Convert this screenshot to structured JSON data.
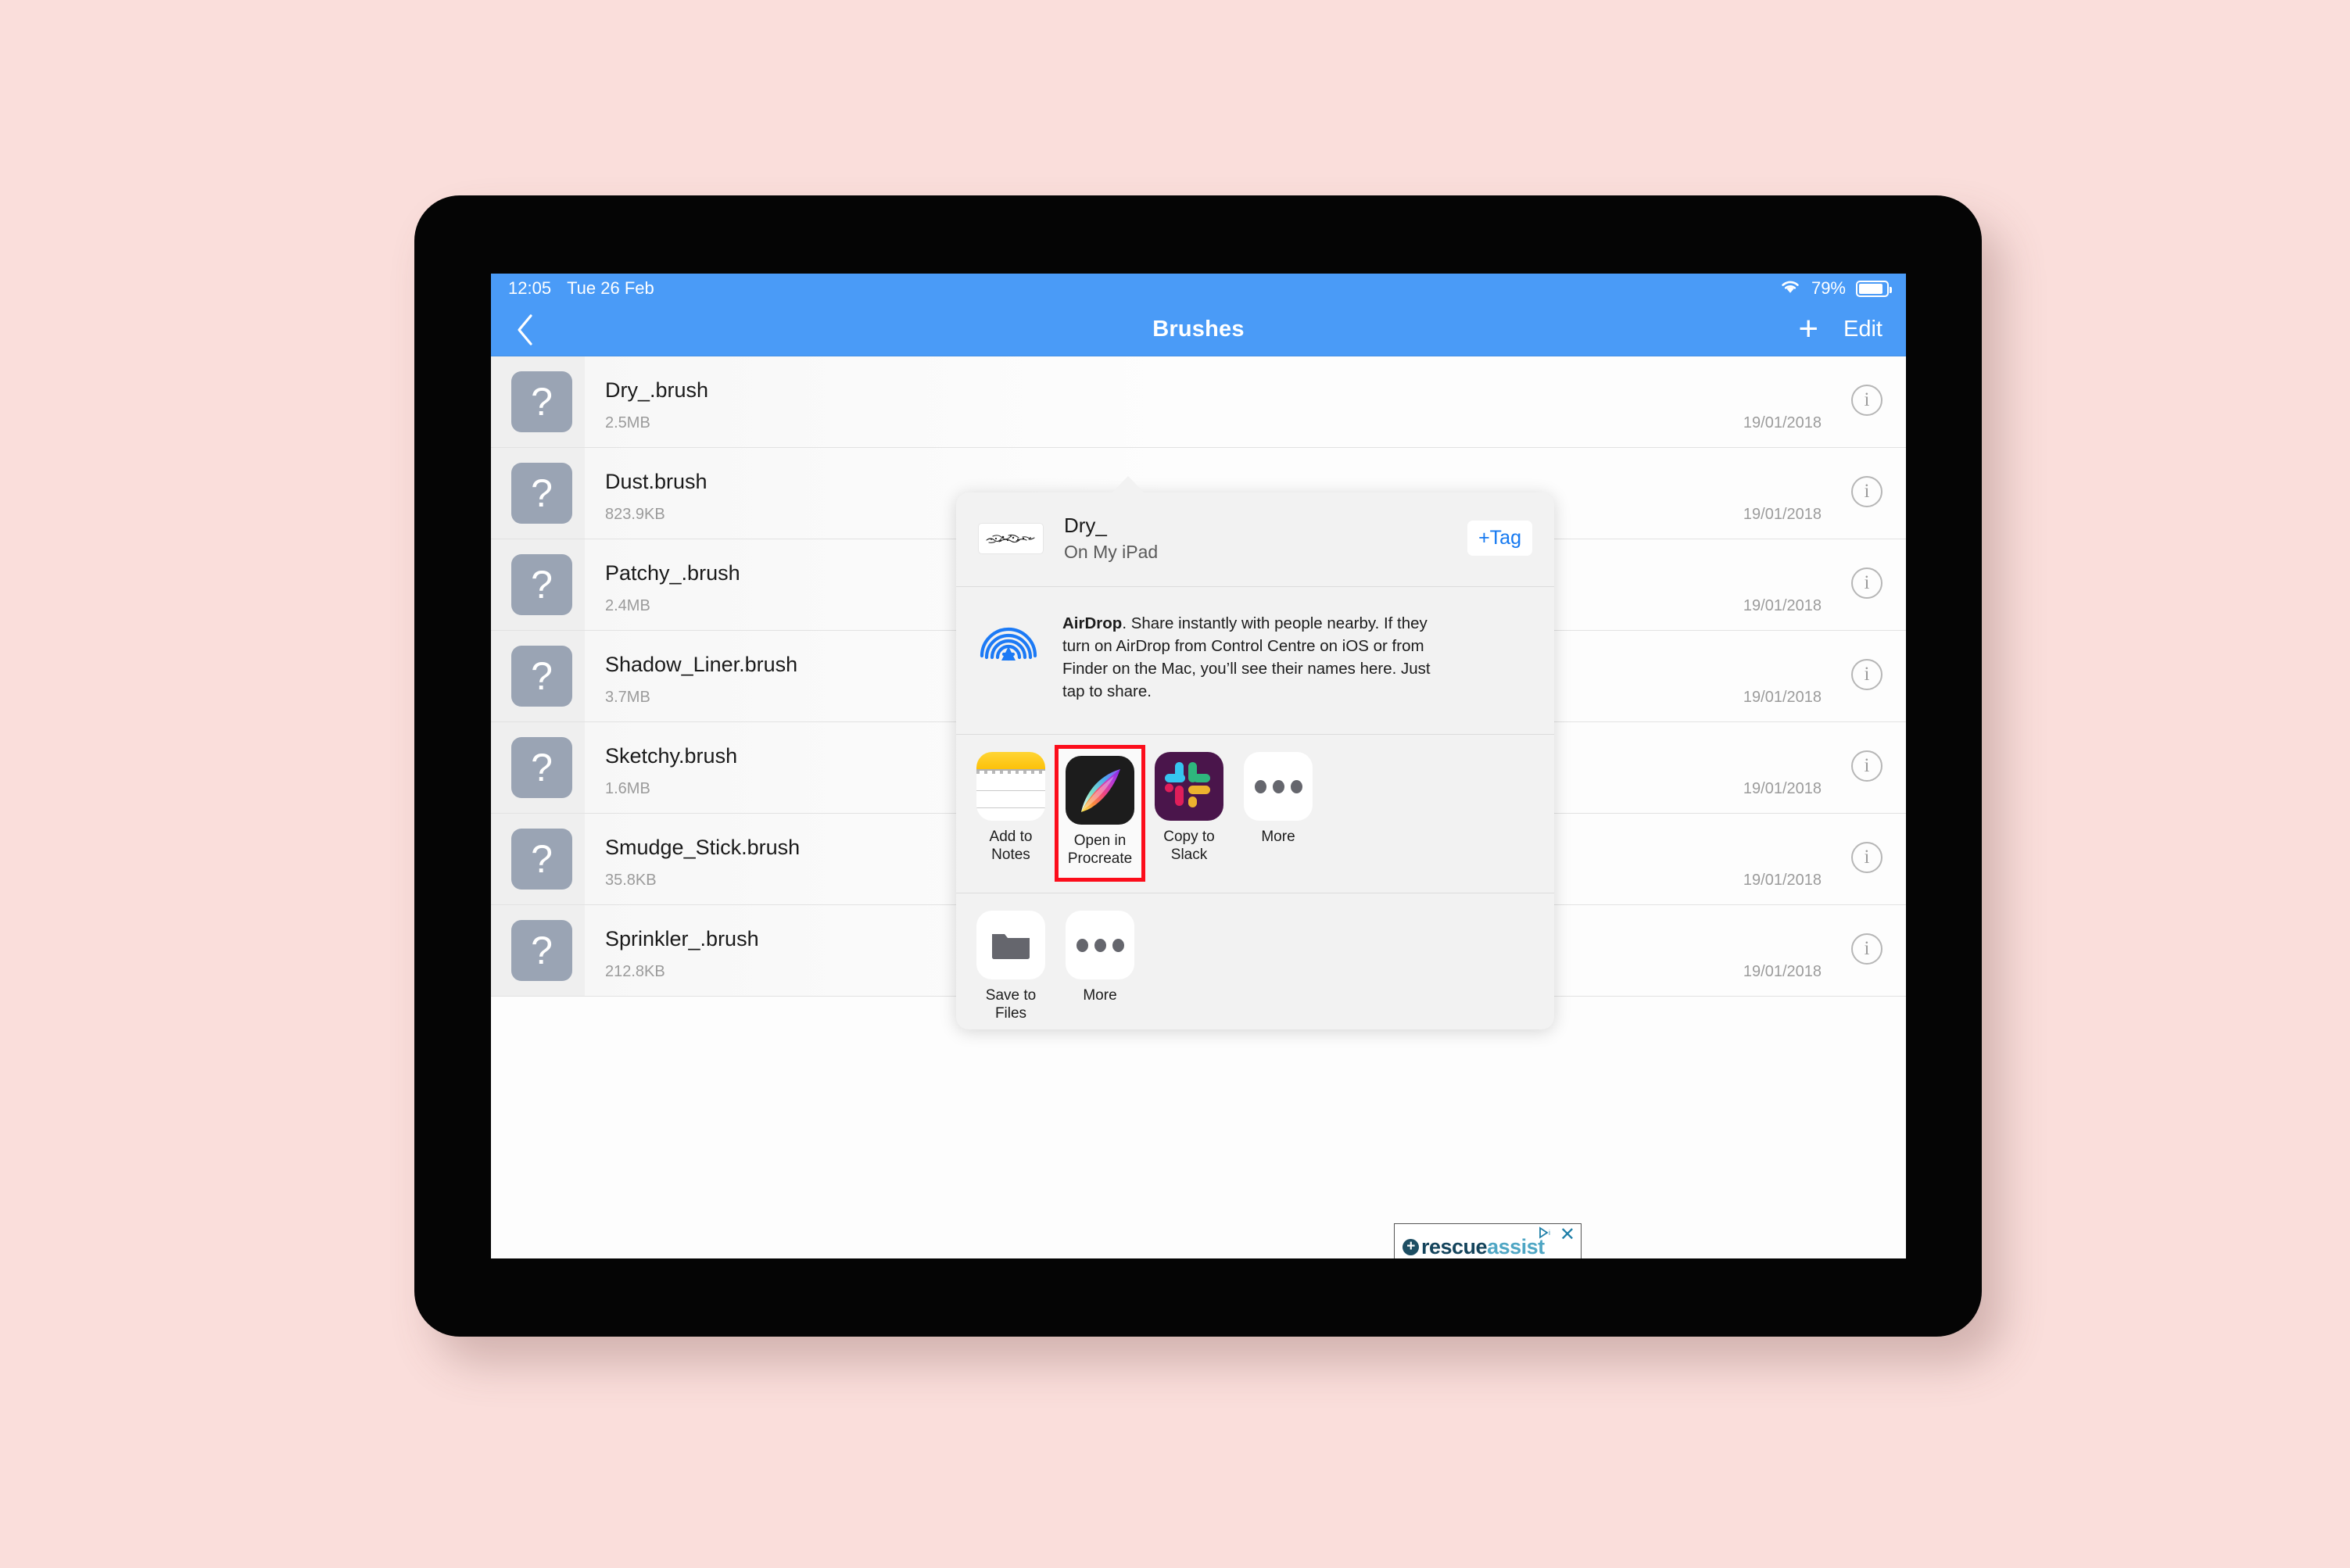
{
  "status_bar": {
    "time": "12:05",
    "date": "Tue 26 Feb",
    "battery_percent": "79%",
    "wifi_icon": "wifi-icon",
    "battery_icon": "battery-icon"
  },
  "nav_bar": {
    "back_icon": "chevron-left-icon",
    "title": "Brushes",
    "add_label": "+",
    "edit_label": "Edit"
  },
  "file_list": {
    "thumb_glyph": "?",
    "info_glyph": "i",
    "rows": [
      {
        "name": "Dry_.brush",
        "size": "2.5MB",
        "date": "19/01/2018"
      },
      {
        "name": "Dust.brush",
        "size": "823.9KB",
        "date": "19/01/2018"
      },
      {
        "name": "Patchy_.brush",
        "size": "2.4MB",
        "date": "19/01/2018"
      },
      {
        "name": "Shadow_Liner.brush",
        "size": "3.7MB",
        "date": "19/01/2018"
      },
      {
        "name": "Sketchy.brush",
        "size": "1.6MB",
        "date": "19/01/2018"
      },
      {
        "name": "Smudge_Stick.brush",
        "size": "35.8KB",
        "date": "19/01/2018"
      },
      {
        "name": "Sprinkler_.brush",
        "size": "212.8KB",
        "date": "19/01/2018"
      }
    ]
  },
  "share_sheet": {
    "document": {
      "title": "Dry_",
      "subtitle": "On My iPad",
      "preview_icon": "brush-stroke-thumbnail"
    },
    "tag_button": "+Tag",
    "airdrop": {
      "icon": "airdrop-icon",
      "name": "AirDrop",
      "description": ". Share instantly with people nearby. If they turn on AirDrop from Control Centre on iOS or from Finder on the Mac, you’ll see their names here. Just tap to share."
    },
    "app_actions": [
      {
        "label": "Add to Notes",
        "icon": "notes-icon",
        "highlighted": false
      },
      {
        "label": "Open in Procreate",
        "icon": "procreate-icon",
        "highlighted": true
      },
      {
        "label": "Copy to Slack",
        "icon": "slack-icon",
        "highlighted": false
      },
      {
        "label": "More",
        "icon": "more-dots-icon",
        "highlighted": false
      }
    ],
    "share_actions": [
      {
        "label": "Save to Files",
        "icon": "folder-icon"
      },
      {
        "label": "More",
        "icon": "more-dots-icon"
      }
    ]
  },
  "ad_banner": {
    "plus_glyph": "+",
    "brand_primary": "rescue",
    "brand_secondary": "assist",
    "adchoices_icon": "adchoices-icon",
    "close_label": "✕"
  },
  "colors": {
    "page_background": "#fadedb",
    "device_bezel": "#050505",
    "nav_bar_blue": "#4a9bf7",
    "highlight_red": "#fc0d1b",
    "link_blue": "#1478f0",
    "airdrop_blue": "#1c7af5",
    "thumb_gray": "#9aa4b4",
    "slack_purple": "#4a154b"
  }
}
